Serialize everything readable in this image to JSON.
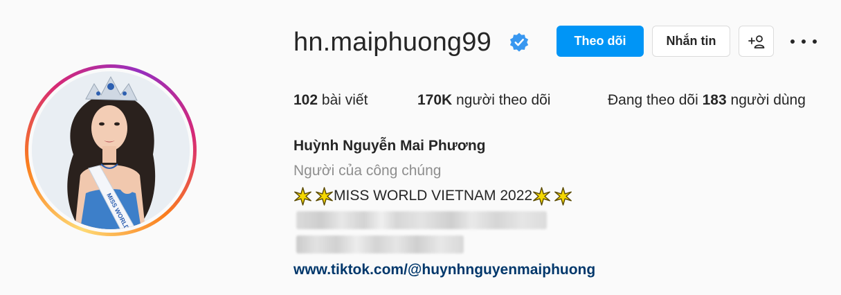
{
  "profile": {
    "username": "hn.maiphuong99",
    "verified": true,
    "full_name": "Huỳnh Nguyễn Mai Phương",
    "category": "Người của công chúng",
    "tagline": "MISS WORLD VIETNAM 2022",
    "link": "www.tiktok.com/@huynhnguyenmaiphuong",
    "avatar_icon": "profile-photo"
  },
  "actions": {
    "follow_label": "Theo dõi",
    "message_label": "Nhắn tin",
    "suggest_icon": "add-person-icon",
    "more_icon": "more-options-icon"
  },
  "stats": {
    "posts_count": "102",
    "posts_label": "bài viết",
    "followers_count": "170K",
    "followers_label": "người theo dõi",
    "following_prefix": "Đang theo dõi",
    "following_count": "183",
    "following_suffix": "người dùng"
  },
  "colors": {
    "accent": "#0095f6",
    "link": "#00376b",
    "secondary_text": "#8e8e8e",
    "verified": "#3897f0"
  }
}
